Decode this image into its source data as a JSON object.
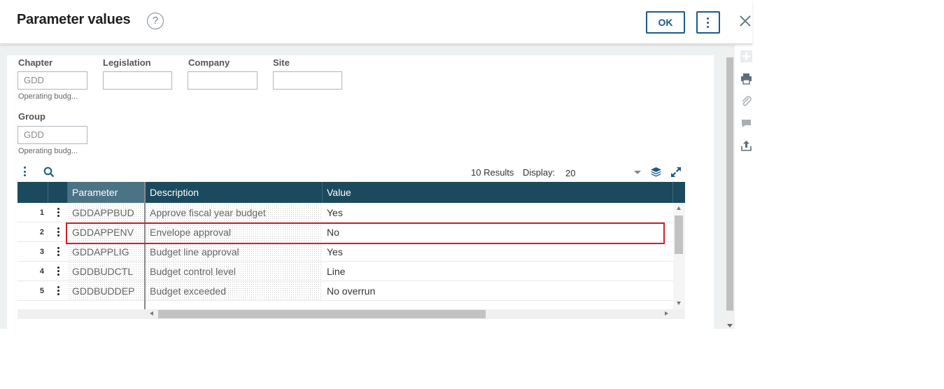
{
  "dialog": {
    "title": "Parameter values",
    "help_glyph": "?",
    "ok_label": "OK"
  },
  "filters": {
    "chapter": {
      "label": "Chapter",
      "value": "GDD",
      "help": "Operating budg..."
    },
    "legislation": {
      "label": "Legislation",
      "value": ""
    },
    "company": {
      "label": "Company",
      "value": ""
    },
    "site": {
      "label": "Site",
      "value": ""
    },
    "group": {
      "label": "Group",
      "value": "GDD",
      "help": "Operating budg..."
    }
  },
  "grid_toolbar": {
    "results": "10 Results",
    "display_label": "Display:",
    "display_value": "20"
  },
  "grid": {
    "columns": [
      "Parameter",
      "Description",
      "Value"
    ],
    "rows": [
      {
        "num": "1",
        "parameter": "GDDAPPBUD",
        "description": "Approve fiscal year budget",
        "value": "Yes"
      },
      {
        "num": "2",
        "parameter": "GDDAPPENV",
        "description": "Envelope approval",
        "value": "No"
      },
      {
        "num": "3",
        "parameter": "GDDAPPLIG",
        "description": "Budget line approval",
        "value": "Yes"
      },
      {
        "num": "4",
        "parameter": "GDDBUDCTL",
        "description": "Budget control level",
        "value": "Line"
      },
      {
        "num": "5",
        "parameter": "GDDBUDDEP",
        "description": "Budget exceeded",
        "value": "No overrun"
      }
    ]
  },
  "colors": {
    "grid_header": "#1b4a5e",
    "accent": "#1e5a86",
    "highlight": "#d0202a"
  },
  "icons": [
    "help-icon",
    "more-icon",
    "close-icon",
    "search-icon",
    "layers-icon",
    "expand-icon",
    "add-icon",
    "print-icon",
    "attachment-icon",
    "comment-icon",
    "export-icon"
  ]
}
